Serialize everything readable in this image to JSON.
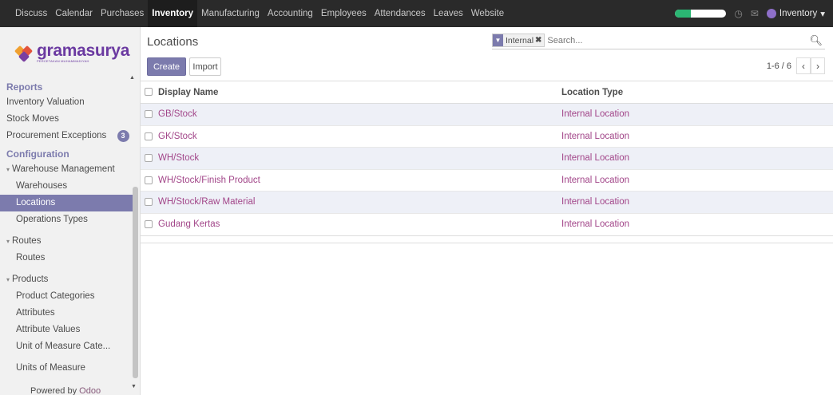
{
  "topbar": {
    "menu": [
      "Discuss",
      "Calendar",
      "Purchases",
      "Inventory",
      "Manufacturing",
      "Accounting",
      "Employees",
      "Attendances",
      "Leaves",
      "Website"
    ],
    "active_menu": "Inventory",
    "user_label": "Inventory",
    "user_caret": "▾",
    "progress_fraction": 0.3
  },
  "logo": {
    "name": "gramasurya",
    "tagline": "PERCETAKAN MUHAMMADIYAH"
  },
  "sidebar": {
    "reports_label": "Reports",
    "inventory_valuation": "Inventory Valuation",
    "stock_moves": "Stock Moves",
    "procurement_exceptions": "Procurement Exceptions",
    "procurement_badge": "3",
    "configuration_label": "Configuration",
    "warehouse_management": "Warehouse Management",
    "warehouses": "Warehouses",
    "locations": "Locations",
    "operations_types": "Operations Types",
    "routes_group": "Routes",
    "routes": "Routes",
    "products_group": "Products",
    "product_categories": "Product Categories",
    "attributes": "Attributes",
    "attribute_values": "Attribute Values",
    "uom_categories": "Unit of Measure Cate...",
    "units_of_measure": "Units of Measure",
    "powered_by": "Powered by",
    "powered_by_brand": "Odoo"
  },
  "control_panel": {
    "title": "Locations",
    "create_label": "Create",
    "import_label": "Import",
    "search_facet": "Internal",
    "search_facet_remove": "✖",
    "search_placeholder": "Search...",
    "pager": "1-6 / 6",
    "pager_prev": "‹",
    "pager_next": "›"
  },
  "table": {
    "headers": {
      "name": "Display Name",
      "type": "Location Type"
    },
    "rows": [
      {
        "name": "GB/Stock",
        "type": "Internal Location"
      },
      {
        "name": "GK/Stock",
        "type": "Internal Location"
      },
      {
        "name": "WH/Stock",
        "type": "Internal Location"
      },
      {
        "name": "WH/Stock/Finish Product",
        "type": "Internal Location"
      },
      {
        "name": "WH/Stock/Raw Material",
        "type": "Internal Location"
      },
      {
        "name": "Gudang Kertas",
        "type": "Internal Location"
      }
    ]
  },
  "colors": {
    "accent": "#7c7bad",
    "link": "#a24689",
    "topbar": "#2a2a2a"
  }
}
